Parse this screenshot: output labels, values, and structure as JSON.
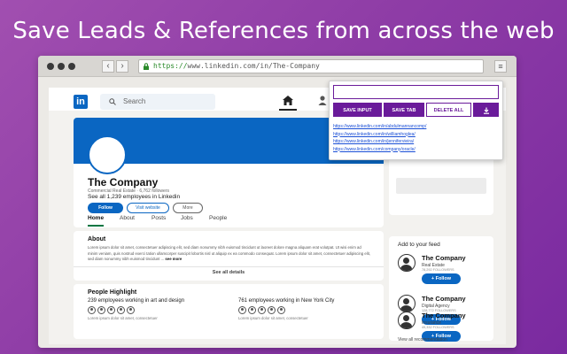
{
  "headline": "Save Leads & References from across the web",
  "browser": {
    "url_scheme": "https://",
    "url_rest": "www.linkedin.com/in/The-Company",
    "back_label": "‹",
    "forward_label": "›",
    "menu_label": "≡"
  },
  "linkedin": {
    "logo": "in",
    "search_placeholder": "Search",
    "company": {
      "name": "The Company",
      "subtitle": "Commercial Real Estate · 6,762 followers",
      "employees": "See all 1,239 employees in Linkedin",
      "follow_label": "Follow",
      "visit_label": "Visit website",
      "more_label": "More"
    },
    "tabs": [
      {
        "label": "Home"
      },
      {
        "label": "About"
      },
      {
        "label": "Posts"
      },
      {
        "label": "Jobs"
      },
      {
        "label": "People"
      }
    ],
    "about": {
      "title": "About",
      "text": "Lorem ipsum dolor sit amet, consectetuer adipiscing elit, sed diam nonummy nibh euismod tincidunt ut laoreet dolore magna aliquam erat volutpat. Ut wisi enim ad minim veniam, quis nostrud exerci tation ullamcorper suscipit lobortis nisl ut aliquip ex ea commodo consequat. Lorem ipsum dolor sit amet, consectetuer adipiscing elit, sed diam nonummy nibh euismod tincidunt ... ",
      "see_more": "see more",
      "see_all": "See all details"
    },
    "people": {
      "title": "People Highlight",
      "col1_stat": "239 employees working in art and design",
      "col2_stat": "761 employees working in New York City",
      "lorem": "Lorem ipsum dolor sit amet, consectetuer"
    },
    "feed": {
      "title": "Add to your feed",
      "items": [
        {
          "name": "The Company",
          "type": "Real Estate",
          "count": "78,292 FOLLOWERS",
          "follow": "+ Follow"
        },
        {
          "name": "The Company",
          "type": "Digital Agency",
          "count": "128,772 FOLLOWERS",
          "follow": "+ Follow"
        },
        {
          "name": "The Company",
          "type": "Insurance",
          "count": "49,332 FOLLOWERS",
          "follow": "+ Follow"
        }
      ],
      "view_all": "View all recommendation"
    }
  },
  "popup": {
    "input_value": "",
    "save_input": "SAVE INPUT",
    "save_tab": "SAVE TAB",
    "delete_all": "DELETE ALL",
    "links": [
      "https://www.linkedin.com/in/abdulmannancomp/",
      "https://www.linkedin.com/in/williamhoglea/",
      "https://www.linkedin.com/in/jennifervieira/",
      "https://www.linkedin.com/company/oracle/"
    ]
  },
  "colors": {
    "background": "#8e3ca6",
    "linkedin_blue": "#0a66c2",
    "extension_purple": "#6a1b9a"
  }
}
